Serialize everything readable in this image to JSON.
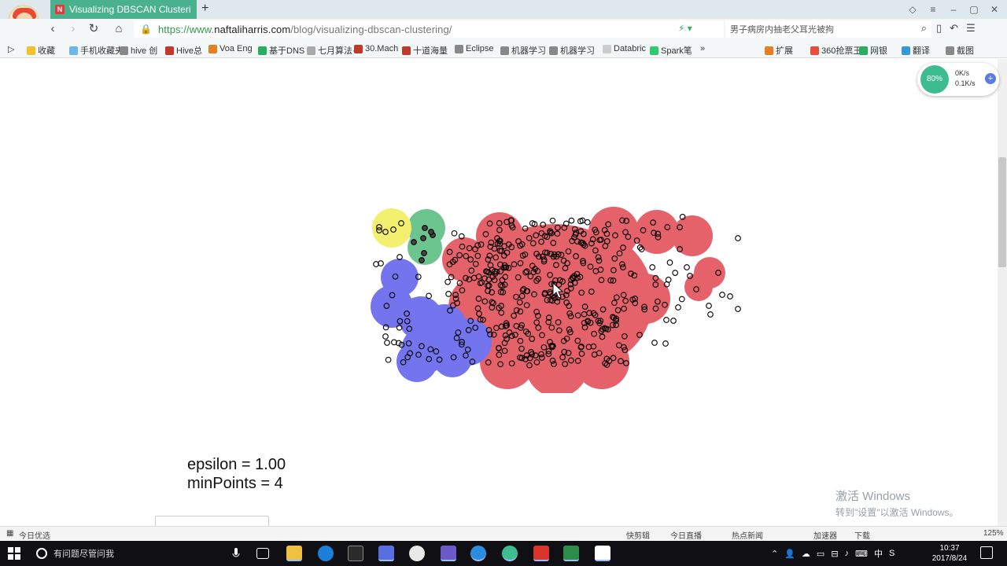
{
  "browser": {
    "tab_title": "Visualizing DBSCAN Clusteri",
    "tab_icon_letter": "N",
    "new_tab": "+",
    "url_prefix": "https://www.",
    "url_host": "naftaliharris.com",
    "url_path": "/blog/visualizing-dbscan-clustering/",
    "search_text": "男子病房内抽老父耳光被拘",
    "colors": {
      "tab": "#4ab18f",
      "url_secure": "#2e9a4a"
    }
  },
  "bookmarks": [
    {
      "label": "收藏",
      "color": "#f2c12e"
    },
    {
      "label": "手机收藏夹",
      "color": "#6bb7e8"
    },
    {
      "label": "hive 创",
      "color": "#888888"
    },
    {
      "label": "Hive总",
      "color": "#c0392b"
    },
    {
      "label": "Voa Eng",
      "color": "#e67e22"
    },
    {
      "label": "基于DNS",
      "color": "#27ae60"
    },
    {
      "label": "七月算法·",
      "color": "#aaaaaa"
    },
    {
      "label": "30.Mach",
      "color": "#c0392b"
    },
    {
      "label": "十道海量",
      "color": "#c0392b"
    },
    {
      "label": "Eclipse",
      "color": "#888888"
    },
    {
      "label": "机器学习",
      "color": "#888888"
    },
    {
      "label": "机器学习",
      "color": "#888888"
    },
    {
      "label": "Databric",
      "color": "#cccccc"
    },
    {
      "label": "Spark笔",
      "color": "#2ecc71"
    },
    {
      "label": "»",
      "color": ""
    }
  ],
  "bookmarks_right": [
    {
      "label": "扩展",
      "color": "#e67e22"
    },
    {
      "label": "360抢票王",
      "color": "#e74c3c"
    },
    {
      "label": "网银",
      "color": "#27ae60"
    },
    {
      "label": "翻译",
      "color": "#3498db"
    },
    {
      "label": "截图",
      "color": "#888888"
    }
  ],
  "speed_widget": {
    "ball": "80%",
    "up": "0K/s",
    "down": "0.1K/s"
  },
  "dbscan": {
    "epsilon_text": "epsilon = 1.00",
    "minpoints_text": "minPoints = 4",
    "epsilon": 1.0,
    "min_points": 4,
    "clusters": [
      {
        "name": "yellow",
        "color": "#f3ef6f"
      },
      {
        "name": "green",
        "color": "#6cc48e"
      },
      {
        "name": "blue",
        "color": "#7474ee"
      },
      {
        "name": "red",
        "color": "#e5626b"
      }
    ]
  },
  "watermark": {
    "line1": "激活 Windows",
    "line2": "转到\"设置\"以激活 Windows。"
  },
  "statusbar": {
    "left": "今日优选",
    "items": [
      "快剪辑",
      "今日直播",
      "热点新闻",
      "加速器",
      "下载"
    ],
    "zoom": "125%"
  },
  "taskbar": {
    "search": "有问题尽管问我",
    "time": "10:37",
    "date": "2017/8/24",
    "ime": "中"
  }
}
